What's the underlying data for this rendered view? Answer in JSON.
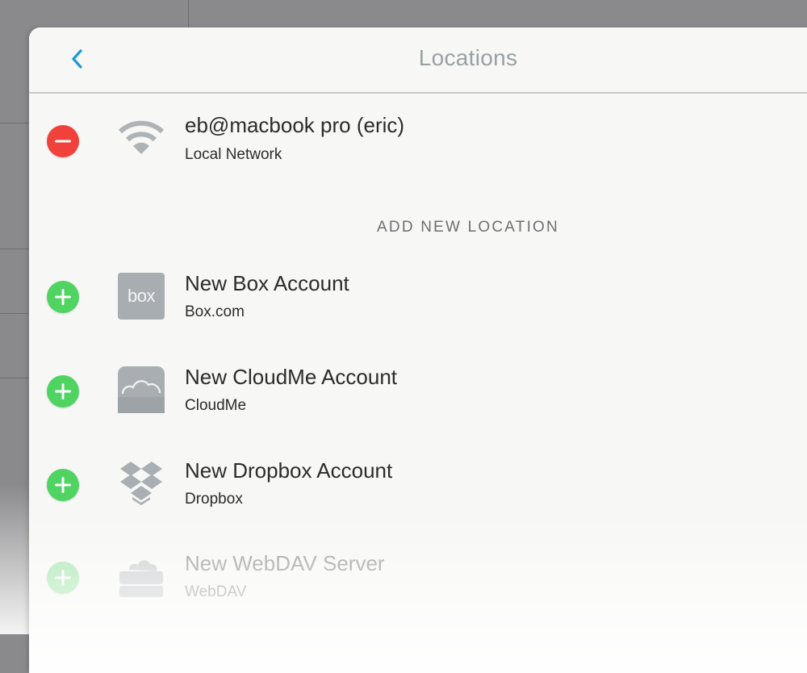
{
  "nav": {
    "title": "Locations",
    "back_icon": "chevron-left-icon",
    "accent_color": "#1d9ad6"
  },
  "current_location": {
    "title": "eb@macbook pro (eric)",
    "subtitle": "Local Network",
    "icon": "wifi-icon",
    "action": "remove",
    "action_color": "#f0413a"
  },
  "section_header": "ADD NEW LOCATION",
  "new_locations": [
    {
      "title": "New Box Account",
      "subtitle": "Box.com",
      "icon": "box-logo-icon",
      "logo_text": "box"
    },
    {
      "title": "New CloudMe Account",
      "subtitle": "CloudMe",
      "icon": "cloudme-icon"
    },
    {
      "title": "New Dropbox Account",
      "subtitle": "Dropbox",
      "icon": "dropbox-icon"
    },
    {
      "title": "New WebDAV Server",
      "subtitle": "WebDAV",
      "icon": "webdav-server-icon"
    }
  ],
  "add_color": "#4fd462"
}
